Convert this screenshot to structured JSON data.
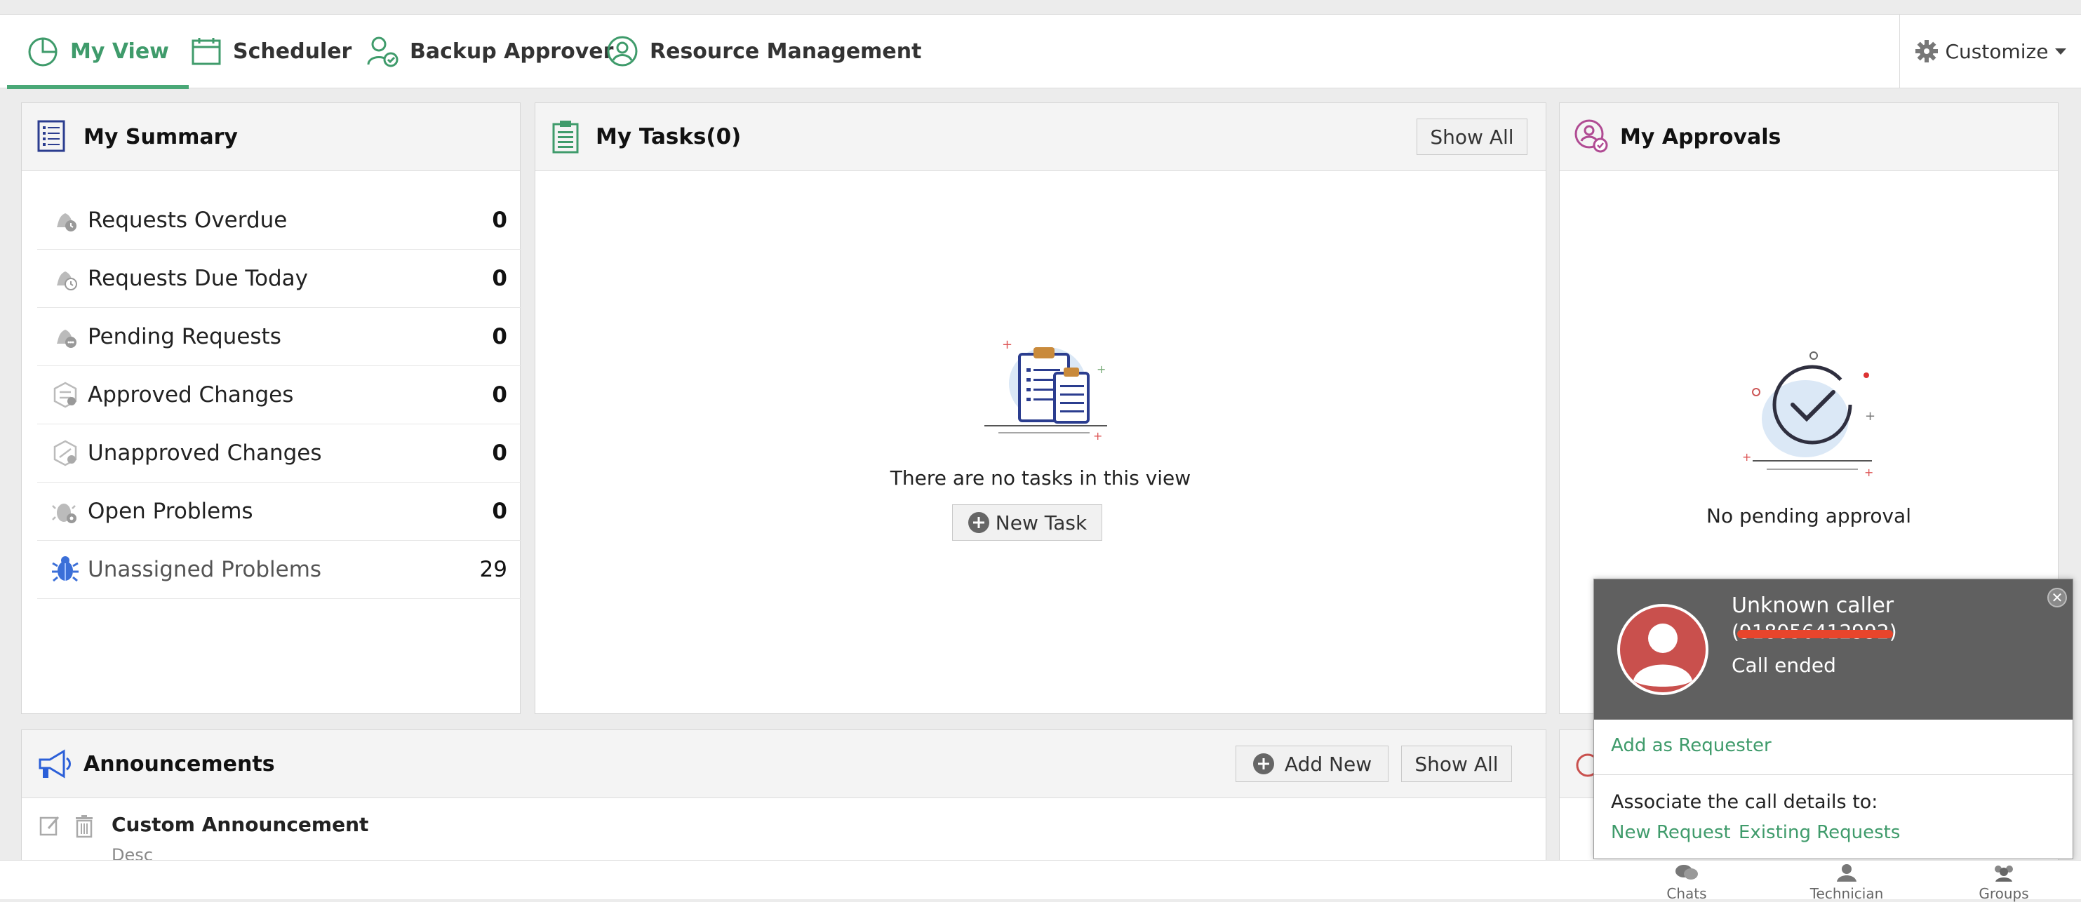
{
  "tabs": [
    {
      "label": "My View",
      "icon": "pie-chart-icon",
      "active": true
    },
    {
      "label": "Scheduler",
      "icon": "calendar-icon",
      "active": false
    },
    {
      "label": "Backup Approver",
      "icon": "user-check-icon",
      "active": false
    },
    {
      "label": "Resource Management",
      "icon": "user-circle-icon",
      "active": false
    }
  ],
  "customize_label": "Customize",
  "summary": {
    "title": "My Summary",
    "items": [
      {
        "label": "Requests Overdue",
        "count": "0"
      },
      {
        "label": "Requests Due Today",
        "count": "0"
      },
      {
        "label": "Pending Requests",
        "count": "0"
      },
      {
        "label": "Approved Changes",
        "count": "0"
      },
      {
        "label": "Unapproved Changes",
        "count": "0"
      },
      {
        "label": "Open Problems",
        "count": "0"
      },
      {
        "label": "Unassigned Problems",
        "count": "29"
      }
    ]
  },
  "tasks": {
    "title": "My Tasks(0)",
    "show_all": "Show All",
    "empty_message": "There are no tasks in this view",
    "new_task": "New Task"
  },
  "approvals": {
    "title": "My Approvals",
    "empty_message": "No pending approval"
  },
  "announcements": {
    "title": "Announcements",
    "add_new": "Add New",
    "show_all": "Show All",
    "item_title": "Custom Announcement",
    "item_desc": "Desc"
  },
  "call_popup": {
    "caller": "Unknown caller",
    "number_redacted": "(918056412992)",
    "status": "Call ended",
    "add_as_requester": "Add as Requester",
    "associate_label": "Associate the call details to:",
    "new_request": "New Request",
    "existing_requests": "Existing Requests"
  },
  "bottom_bar": [
    {
      "label": "Chats",
      "icon": "chat-icon"
    },
    {
      "label": "Technician",
      "icon": "person-icon"
    },
    {
      "label": "Groups",
      "icon": "group-icon"
    }
  ],
  "colors": {
    "accent": "#3f9b6b",
    "popup_dark": "#606060",
    "avatar": "#c9504d",
    "redaction": "#e8452c"
  }
}
